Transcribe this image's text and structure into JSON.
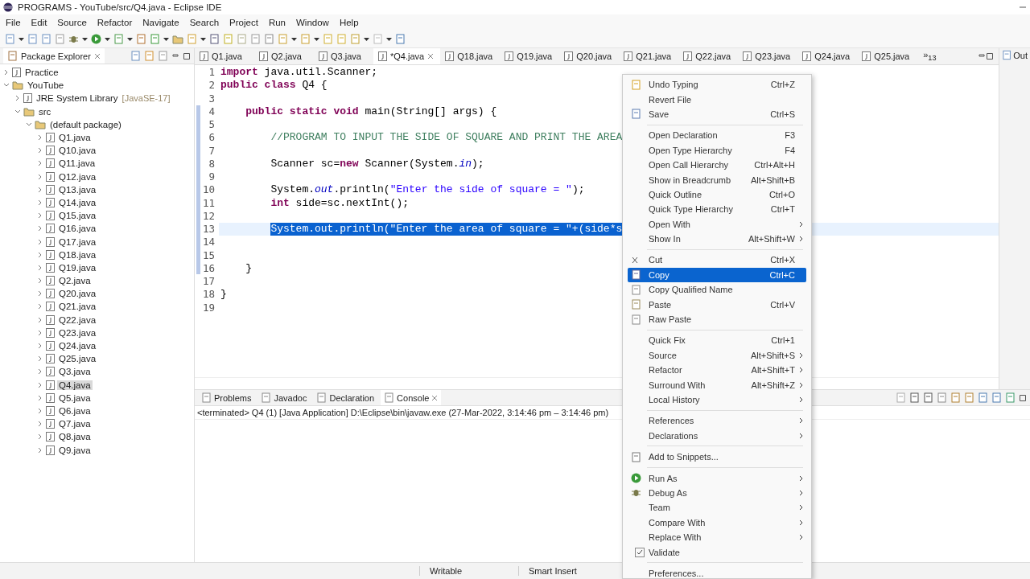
{
  "window": {
    "title": "PROGRAMS - YouTube/src/Q4.java - Eclipse IDE"
  },
  "menu_bar": [
    "File",
    "Edit",
    "Source",
    "Refactor",
    "Navigate",
    "Search",
    "Project",
    "Run",
    "Window",
    "Help"
  ],
  "package_explorer": {
    "title": "Package Explorer",
    "tree": [
      {
        "label": "Practice",
        "expanded": false,
        "selected": false
      },
      {
        "label": "YouTube",
        "expanded": true,
        "selected": false,
        "children": [
          {
            "label": "JRE System Library",
            "decoration": "[JavaSE-17]",
            "expanded": false,
            "selected": false
          },
          {
            "label": "src",
            "expanded": true,
            "selected": false,
            "children": [
              {
                "label": "(default package)",
                "expanded": true,
                "selected": false,
                "children": [
                  {
                    "label": "Q1.java",
                    "expanded": false,
                    "selected": false
                  },
                  {
                    "label": "Q10.java",
                    "expanded": false,
                    "selected": false
                  },
                  {
                    "label": "Q11.java",
                    "expanded": false,
                    "selected": false
                  },
                  {
                    "label": "Q12.java",
                    "expanded": false,
                    "selected": false
                  },
                  {
                    "label": "Q13.java",
                    "expanded": false,
                    "selected": false
                  },
                  {
                    "label": "Q14.java",
                    "expanded": false,
                    "selected": false
                  },
                  {
                    "label": "Q15.java",
                    "expanded": false,
                    "selected": false
                  },
                  {
                    "label": "Q16.java",
                    "expanded": false,
                    "selected": false
                  },
                  {
                    "label": "Q17.java",
                    "expanded": false,
                    "selected": false
                  },
                  {
                    "label": "Q18.java",
                    "expanded": false,
                    "selected": false
                  },
                  {
                    "label": "Q19.java",
                    "expanded": false,
                    "selected": false
                  },
                  {
                    "label": "Q2.java",
                    "expanded": false,
                    "selected": false
                  },
                  {
                    "label": "Q20.java",
                    "expanded": false,
                    "selected": false
                  },
                  {
                    "label": "Q21.java",
                    "expanded": false,
                    "selected": false
                  },
                  {
                    "label": "Q22.java",
                    "expanded": false,
                    "selected": false
                  },
                  {
                    "label": "Q23.java",
                    "expanded": false,
                    "selected": false
                  },
                  {
                    "label": "Q24.java",
                    "expanded": false,
                    "selected": false
                  },
                  {
                    "label": "Q25.java",
                    "expanded": false,
                    "selected": false
                  },
                  {
                    "label": "Q3.java",
                    "expanded": false,
                    "selected": false
                  },
                  {
                    "label": "Q4.java",
                    "expanded": false,
                    "selected": true
                  },
                  {
                    "label": "Q5.java",
                    "expanded": false,
                    "selected": false
                  },
                  {
                    "label": "Q6.java",
                    "expanded": false,
                    "selected": false
                  },
                  {
                    "label": "Q7.java",
                    "expanded": false,
                    "selected": false
                  },
                  {
                    "label": "Q8.java",
                    "expanded": false,
                    "selected": false
                  },
                  {
                    "label": "Q9.java",
                    "expanded": false,
                    "selected": false
                  }
                ]
              }
            ]
          }
        ]
      }
    ]
  },
  "editor_tabs": [
    {
      "label": "Q1.java",
      "selected": false
    },
    {
      "label": "Q2.java",
      "selected": false
    },
    {
      "label": "Q3.java",
      "selected": false
    },
    {
      "label": "*Q4.java",
      "selected": true
    },
    {
      "label": "Q18.java",
      "selected": false
    },
    {
      "label": "Q19.java",
      "selected": false
    },
    {
      "label": "Q20.java",
      "selected": false
    },
    {
      "label": "Q21.java",
      "selected": false
    },
    {
      "label": "Q22.java",
      "selected": false
    },
    {
      "label": "Q23.java",
      "selected": false
    },
    {
      "label": "Q24.java",
      "selected": false
    },
    {
      "label": "Q25.java",
      "selected": false
    }
  ],
  "tabs_overflow": "»$_{13}$",
  "outline_tab": "Out",
  "code_lines": [
    {
      "number": "1",
      "kind": "top",
      "selected": false,
      "tokens": [
        {
          "kind": "keyword",
          "text": "import"
        },
        {
          "kind": "plain",
          "text": " java.util.Scanner;"
        }
      ]
    },
    {
      "number": "2",
      "kind": "top",
      "selected": false,
      "tokens": [
        {
          "kind": "keyword",
          "text": "public class"
        },
        {
          "kind": "plain",
          "text": " Q4 {"
        }
      ]
    },
    {
      "number": "3",
      "selected": false
    },
    {
      "number": "4",
      "kind": "member",
      "selected": false,
      "tokens": [
        {
          "kind": "keyword",
          "text": "public static void"
        },
        {
          "kind": "plain",
          "text": " main(String[] args) {"
        }
      ]
    },
    {
      "number": "5",
      "selected": false
    },
    {
      "number": "6",
      "kind": "body",
      "selected": false,
      "tokens": [
        {
          "kind": "comment",
          "text": "//PROGRAM TO INPUT THE SIDE OF SQUARE AND PRINT THE AREA"
        }
      ]
    },
    {
      "number": "7",
      "selected": false
    },
    {
      "number": "8",
      "kind": "body",
      "selected": false,
      "tokens": [
        {
          "kind": "plain",
          "text": "Scanner sc="
        },
        {
          "kind": "keyword",
          "text": "new"
        },
        {
          "kind": "plain",
          "text": " Scanner(System."
        },
        {
          "kind": "field",
          "text": "in"
        },
        {
          "kind": "plain",
          "text": ");"
        }
      ]
    },
    {
      "number": "9",
      "selected": false
    },
    {
      "number": "10",
      "kind": "body",
      "selected": false,
      "tokens": [
        {
          "kind": "plain",
          "text": "System."
        },
        {
          "kind": "field",
          "text": "out"
        },
        {
          "kind": "plain",
          "text": ".println("
        },
        {
          "kind": "string",
          "text": "\"Enter the side of square = \""
        },
        {
          "kind": "plain",
          "text": ");"
        }
      ]
    },
    {
      "number": "11",
      "kind": "body",
      "selected": false,
      "tokens": [
        {
          "kind": "keyword",
          "text": "int"
        },
        {
          "kind": "plain",
          "text": " side=sc.nextInt();"
        }
      ]
    },
    {
      "number": "12",
      "selected": false
    },
    {
      "number": "13",
      "kind": "body",
      "selected": true,
      "tokens": [
        {
          "kind": "selection",
          "text": "System.out.println(\"Enter the area of square = \"+(side*s"
        }
      ]
    },
    {
      "number": "14",
      "selected": false
    },
    {
      "number": "15",
      "selected": false
    },
    {
      "number": "16",
      "kind": "member",
      "selected": false,
      "tokens": [
        {
          "kind": "plain",
          "text": "}"
        }
      ]
    },
    {
      "number": "17",
      "selected": false
    },
    {
      "number": "18",
      "kind": "top",
      "selected": false,
      "tokens": [
        {
          "kind": "plain",
          "text": "}"
        }
      ]
    },
    {
      "number": "19",
      "selected": false
    }
  ],
  "bottom_tabs": [
    {
      "label": "Problems",
      "selected": false
    },
    {
      "label": "Javadoc",
      "selected": false
    },
    {
      "label": "Declaration",
      "selected": false
    },
    {
      "label": "Console",
      "selected": true
    }
  ],
  "console_header": "<terminated> Q4 (1) [Java Application] D:\\Eclipse\\bin\\javaw.exe  (27-Mar-2022, 3:14:46 pm – 3:14:46 pm)",
  "status_bar": [
    "Writable",
    "Smart Insert"
  ],
  "context_menu": [
    {
      "kind": "item",
      "label": "Undo Typing",
      "shortcut": "Ctrl+Z",
      "submenu": false,
      "selected": false
    },
    {
      "kind": "item",
      "label": "Revert File",
      "submenu": false,
      "selected": false
    },
    {
      "kind": "item",
      "label": "Save",
      "shortcut": "Ctrl+S",
      "submenu": false,
      "selected": false
    },
    {
      "kind": "separator"
    },
    {
      "kind": "item",
      "label": "Open Declaration",
      "shortcut": "F3",
      "submenu": false,
      "selected": false
    },
    {
      "kind": "item",
      "label": "Open Type Hierarchy",
      "shortcut": "F4",
      "submenu": false,
      "selected": false
    },
    {
      "kind": "item",
      "label": "Open Call Hierarchy",
      "shortcut": "Ctrl+Alt+H",
      "submenu": false,
      "selected": false
    },
    {
      "kind": "item",
      "label": "Show in Breadcrumb",
      "shortcut": "Alt+Shift+B",
      "submenu": false,
      "selected": false
    },
    {
      "kind": "item",
      "label": "Quick Outline",
      "shortcut": "Ctrl+O",
      "submenu": false,
      "selected": false
    },
    {
      "kind": "item",
      "label": "Quick Type Hierarchy",
      "shortcut": "Ctrl+T",
      "submenu": false,
      "selected": false
    },
    {
      "kind": "item",
      "label": "Open With",
      "submenu": true,
      "selected": false
    },
    {
      "kind": "item",
      "label": "Show In",
      "shortcut": "Alt+Shift+W",
      "submenu": true,
      "selected": false
    },
    {
      "kind": "separator"
    },
    {
      "kind": "item",
      "label": "Cut",
      "shortcut": "Ctrl+X",
      "submenu": false,
      "selected": false
    },
    {
      "kind": "item",
      "label": "Copy",
      "shortcut": "Ctrl+C",
      "submenu": false,
      "selected": true
    },
    {
      "kind": "item",
      "label": "Copy Qualified Name",
      "submenu": false,
      "selected": false
    },
    {
      "kind": "item",
      "label": "Paste",
      "shortcut": "Ctrl+V",
      "submenu": false,
      "selected": false
    },
    {
      "kind": "item",
      "label": "Raw Paste",
      "submenu": false,
      "selected": false
    },
    {
      "kind": "separator"
    },
    {
      "kind": "item",
      "label": "Quick Fix",
      "shortcut": "Ctrl+1",
      "submenu": false,
      "selected": false
    },
    {
      "kind": "item",
      "label": "Source",
      "shortcut": "Alt+Shift+S",
      "submenu": true,
      "selected": false
    },
    {
      "kind": "item",
      "label": "Refactor",
      "shortcut": "Alt+Shift+T",
      "submenu": true,
      "selected": false
    },
    {
      "kind": "item",
      "label": "Surround With",
      "shortcut": "Alt+Shift+Z",
      "submenu": true,
      "selected": false
    },
    {
      "kind": "item",
      "label": "Local History",
      "submenu": true,
      "selected": false
    },
    {
      "kind": "separator"
    },
    {
      "kind": "item",
      "label": "References",
      "submenu": true,
      "selected": false
    },
    {
      "kind": "item",
      "label": "Declarations",
      "submenu": true,
      "selected": false
    },
    {
      "kind": "separator"
    },
    {
      "kind": "item",
      "label": "Add to Snippets...",
      "submenu": false,
      "selected": false
    },
    {
      "kind": "separator"
    },
    {
      "kind": "item",
      "label": "Run As",
      "submenu": true,
      "selected": false
    },
    {
      "kind": "item",
      "label": "Debug As",
      "submenu": true,
      "selected": false
    },
    {
      "kind": "item",
      "label": "Team",
      "submenu": true,
      "selected": false
    },
    {
      "kind": "item",
      "label": "Compare With",
      "submenu": true,
      "selected": false
    },
    {
      "kind": "item",
      "label": "Replace With",
      "submenu": true,
      "selected": false
    },
    {
      "kind": "check",
      "label": "Validate",
      "checked": true,
      "submenu": false,
      "selected": false
    },
    {
      "kind": "separator"
    },
    {
      "kind": "item",
      "label": "Preferences...",
      "submenu": false,
      "selected": false
    }
  ]
}
